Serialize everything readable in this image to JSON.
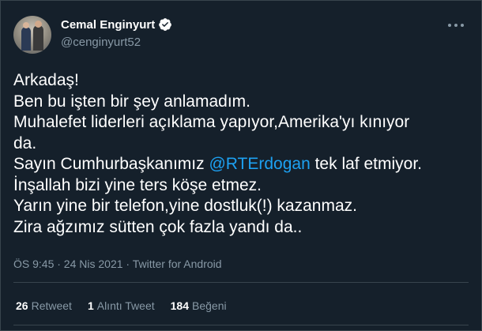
{
  "user": {
    "display_name": "Cemal Enginyurt",
    "handle": "@cenginyurt52",
    "verified": true,
    "avatar_alt": "profile-photo"
  },
  "tweet": {
    "lines": [
      {
        "text": "Arkadaş!"
      },
      {
        "text": "Ben bu işten bir şey anlamadım."
      },
      {
        "text": "Muhalefet liderleri açıklama yapıyor,Amerika'yı kınıyor"
      },
      {
        "text": "da."
      },
      {
        "pre": "Sayın Cumhurbaşkanımız ",
        "mention": "@RTErdogan",
        "post": " tek laf etmiyor."
      },
      {
        "text": "İnşallah bizi yine ters köşe etmez."
      },
      {
        "text": "Yarın yine bir telefon,yine dostluk(!) kazanmaz."
      },
      {
        "text": "Zira ağzımız sütten çok fazla yandı da.."
      }
    ],
    "meta": "ÖS 9:45 · 24 Nis 2021 · Twitter for Android"
  },
  "stats": {
    "retweets_count": "26",
    "retweets_label": "Retweet",
    "quotes_count": "1",
    "quotes_label": "Alıntı Tweet",
    "likes_count": "184",
    "likes_label": "Beğeni"
  },
  "colors": {
    "background": "#15202b",
    "border": "#38444d",
    "secondary_text": "#8899a6",
    "mention": "#1da1f2"
  }
}
